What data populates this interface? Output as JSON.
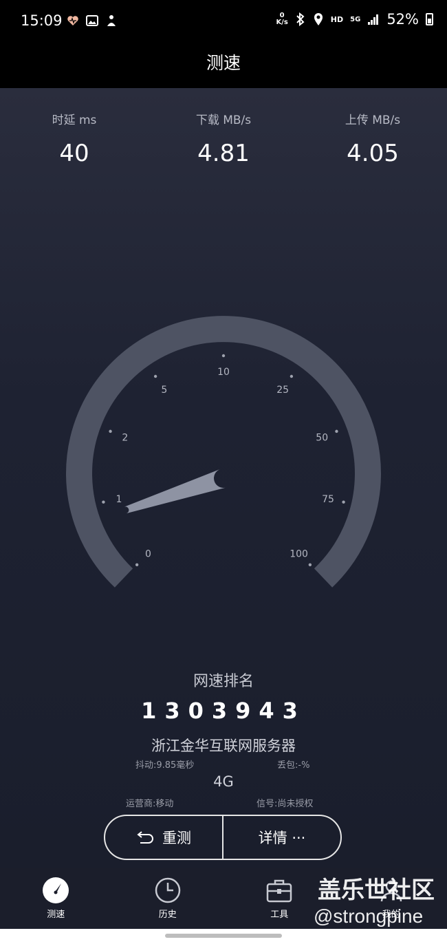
{
  "status_bar": {
    "time": "15:09",
    "net_speed_value": "0",
    "net_speed_unit": "K/s",
    "hd_label": "HD",
    "network_label": "5G",
    "battery_percent": "52%",
    "icons": [
      "heart-icon",
      "gallery-icon",
      "app-icon",
      "bluetooth-icon",
      "location-icon",
      "signal-icon",
      "battery-icon"
    ]
  },
  "header": {
    "title": "测速"
  },
  "metrics": [
    {
      "label": "时延 ms",
      "value": "40"
    },
    {
      "label": "下载 MB/s",
      "value": "4.81"
    },
    {
      "label": "上传 MB/s",
      "value": "4.05"
    }
  ],
  "gauge": {
    "ticks": [
      "0",
      "1",
      "2",
      "5",
      "10",
      "25",
      "50",
      "75",
      "100"
    ],
    "needle_fraction": 0.1,
    "colors": {
      "arc": "#4e5363",
      "needle": "#8e93a3"
    }
  },
  "ranking": {
    "title": "网速排名",
    "number": "1303943",
    "server": "浙江金华互联网服务器",
    "jitter": "抖动:9.85毫秒",
    "packet_loss": "丢包:-%",
    "network_type": "4G",
    "carrier": "运营商:移动",
    "signal": "信号:尚未授权"
  },
  "buttons": {
    "retest_label": "重测",
    "details_label": "详情 ···"
  },
  "nav": {
    "items": [
      {
        "label": "测速"
      },
      {
        "label": "历史"
      },
      {
        "label": "工具"
      },
      {
        "label": "我的"
      }
    ]
  },
  "watermark": {
    "line1": "盖乐世社区",
    "line2": "@strongpine"
  }
}
